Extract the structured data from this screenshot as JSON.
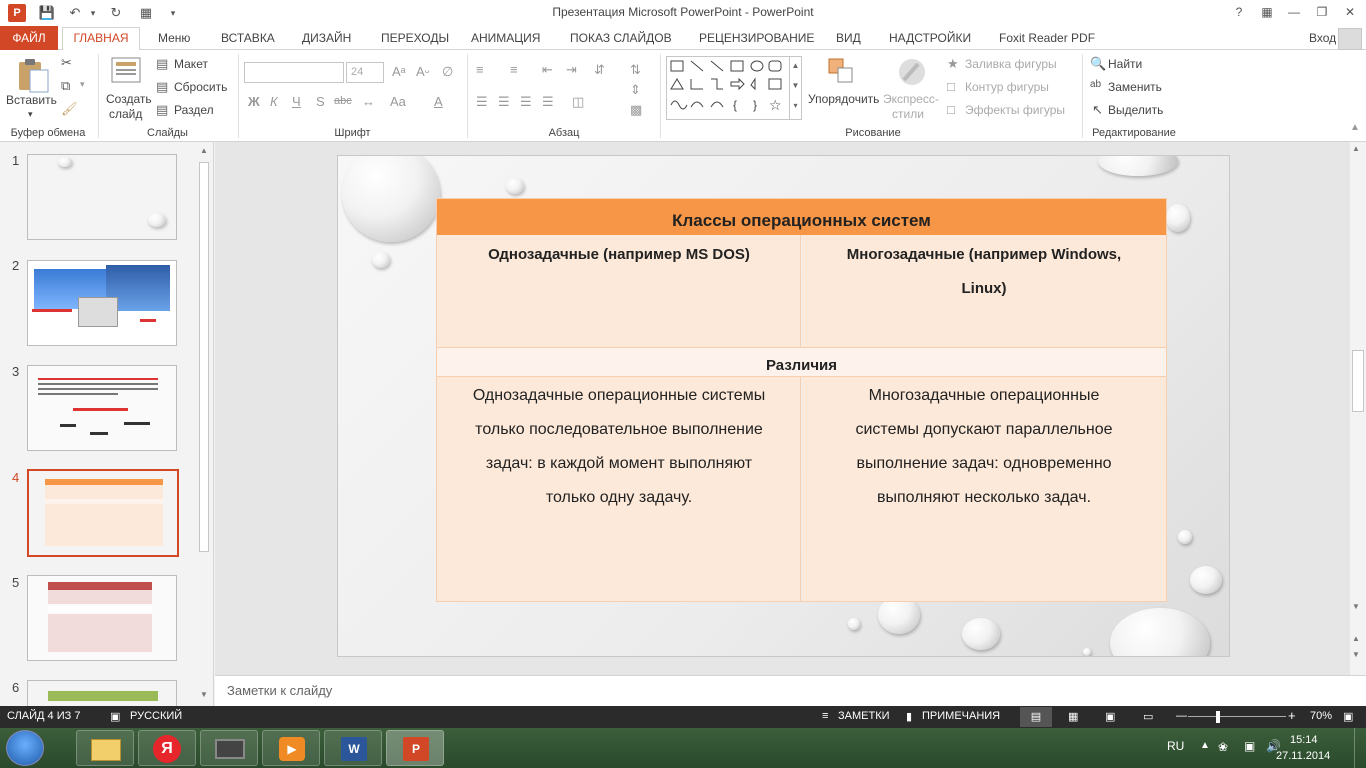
{
  "window": {
    "title": "Презентация Microsoft PowerPoint - PowerPoint",
    "help": "?",
    "login": "Вход"
  },
  "tabs": [
    "ФАЙЛ",
    "ГЛАВНАЯ",
    "Меню",
    "ВСТАВКА",
    "ДИЗАЙН",
    "ПЕРЕХОДЫ",
    "АНИМАЦИЯ",
    "ПОКАЗ СЛАЙДОВ",
    "РЕЦЕНЗИРОВАНИЕ",
    "ВИД",
    "НАДСТРОЙКИ",
    "Foxit Reader PDF"
  ],
  "ribbon": {
    "clipboard": {
      "paste": "Вставить",
      "label": "Буфер обмена"
    },
    "slides": {
      "new_slide_line1": "Создать",
      "new_slide_line2": "слайд",
      "layout": "Макет",
      "reset": "Сбросить",
      "section": "Раздел",
      "label": "Слайды"
    },
    "font": {
      "size": "24",
      "bold": "Ж",
      "italic": "К",
      "underline": "Ч",
      "strike": "S",
      "spacing": "abc",
      "case": "Aa",
      "label": "Шрифт"
    },
    "paragraph": {
      "label": "Абзац"
    },
    "drawing": {
      "arrange": "Упорядочить",
      "styles_line1": "Экспресс-",
      "styles_line2": "стили",
      "fill": "Заливка фигуры",
      "outline": "Контур фигуры",
      "effects": "Эффекты фигуры",
      "label": "Рисование"
    },
    "editing": {
      "find": "Найти",
      "replace": "Заменить",
      "select": "Выделить",
      "label": "Редактирование"
    }
  },
  "thumbnails": [
    {
      "num": "1"
    },
    {
      "num": "2"
    },
    {
      "num": "3"
    },
    {
      "num": "4"
    },
    {
      "num": "5"
    },
    {
      "num": "6"
    }
  ],
  "slide": {
    "table": {
      "header": "Классы операционных систем",
      "col1_title": "Однозадачные (например MS DOS)",
      "col2_title_line1": "Многозадачные (например Windows,",
      "col2_title_line2": "Linux)",
      "diff_header": "Различия",
      "col1_text": [
        "Однозадачные операционные системы",
        "только последовательное выполнение",
        "задач: в каждой момент выполняют",
        "только одну задачу."
      ],
      "col2_text": [
        "Многозадачные операционные",
        "системы допускают параллельное",
        "выполнение задач: одновременно",
        "выполняют несколько задач."
      ]
    }
  },
  "notes_placeholder": "Заметки к слайду",
  "status": {
    "slide_info": "СЛАЙД 4 ИЗ 7",
    "language": "РУССКИЙ",
    "notes": "ЗАМЕТКИ",
    "comments": "ПРИМЕЧАНИЯ",
    "zoom": "70%"
  },
  "taskbar": {
    "lang": "RU",
    "time": "15:14",
    "date": "27.11.2014"
  },
  "colors": {
    "accent": "#d24726",
    "table_header": "#f79646",
    "table_cell": "#fde9d9",
    "table_diff": "#fdf3ec"
  }
}
